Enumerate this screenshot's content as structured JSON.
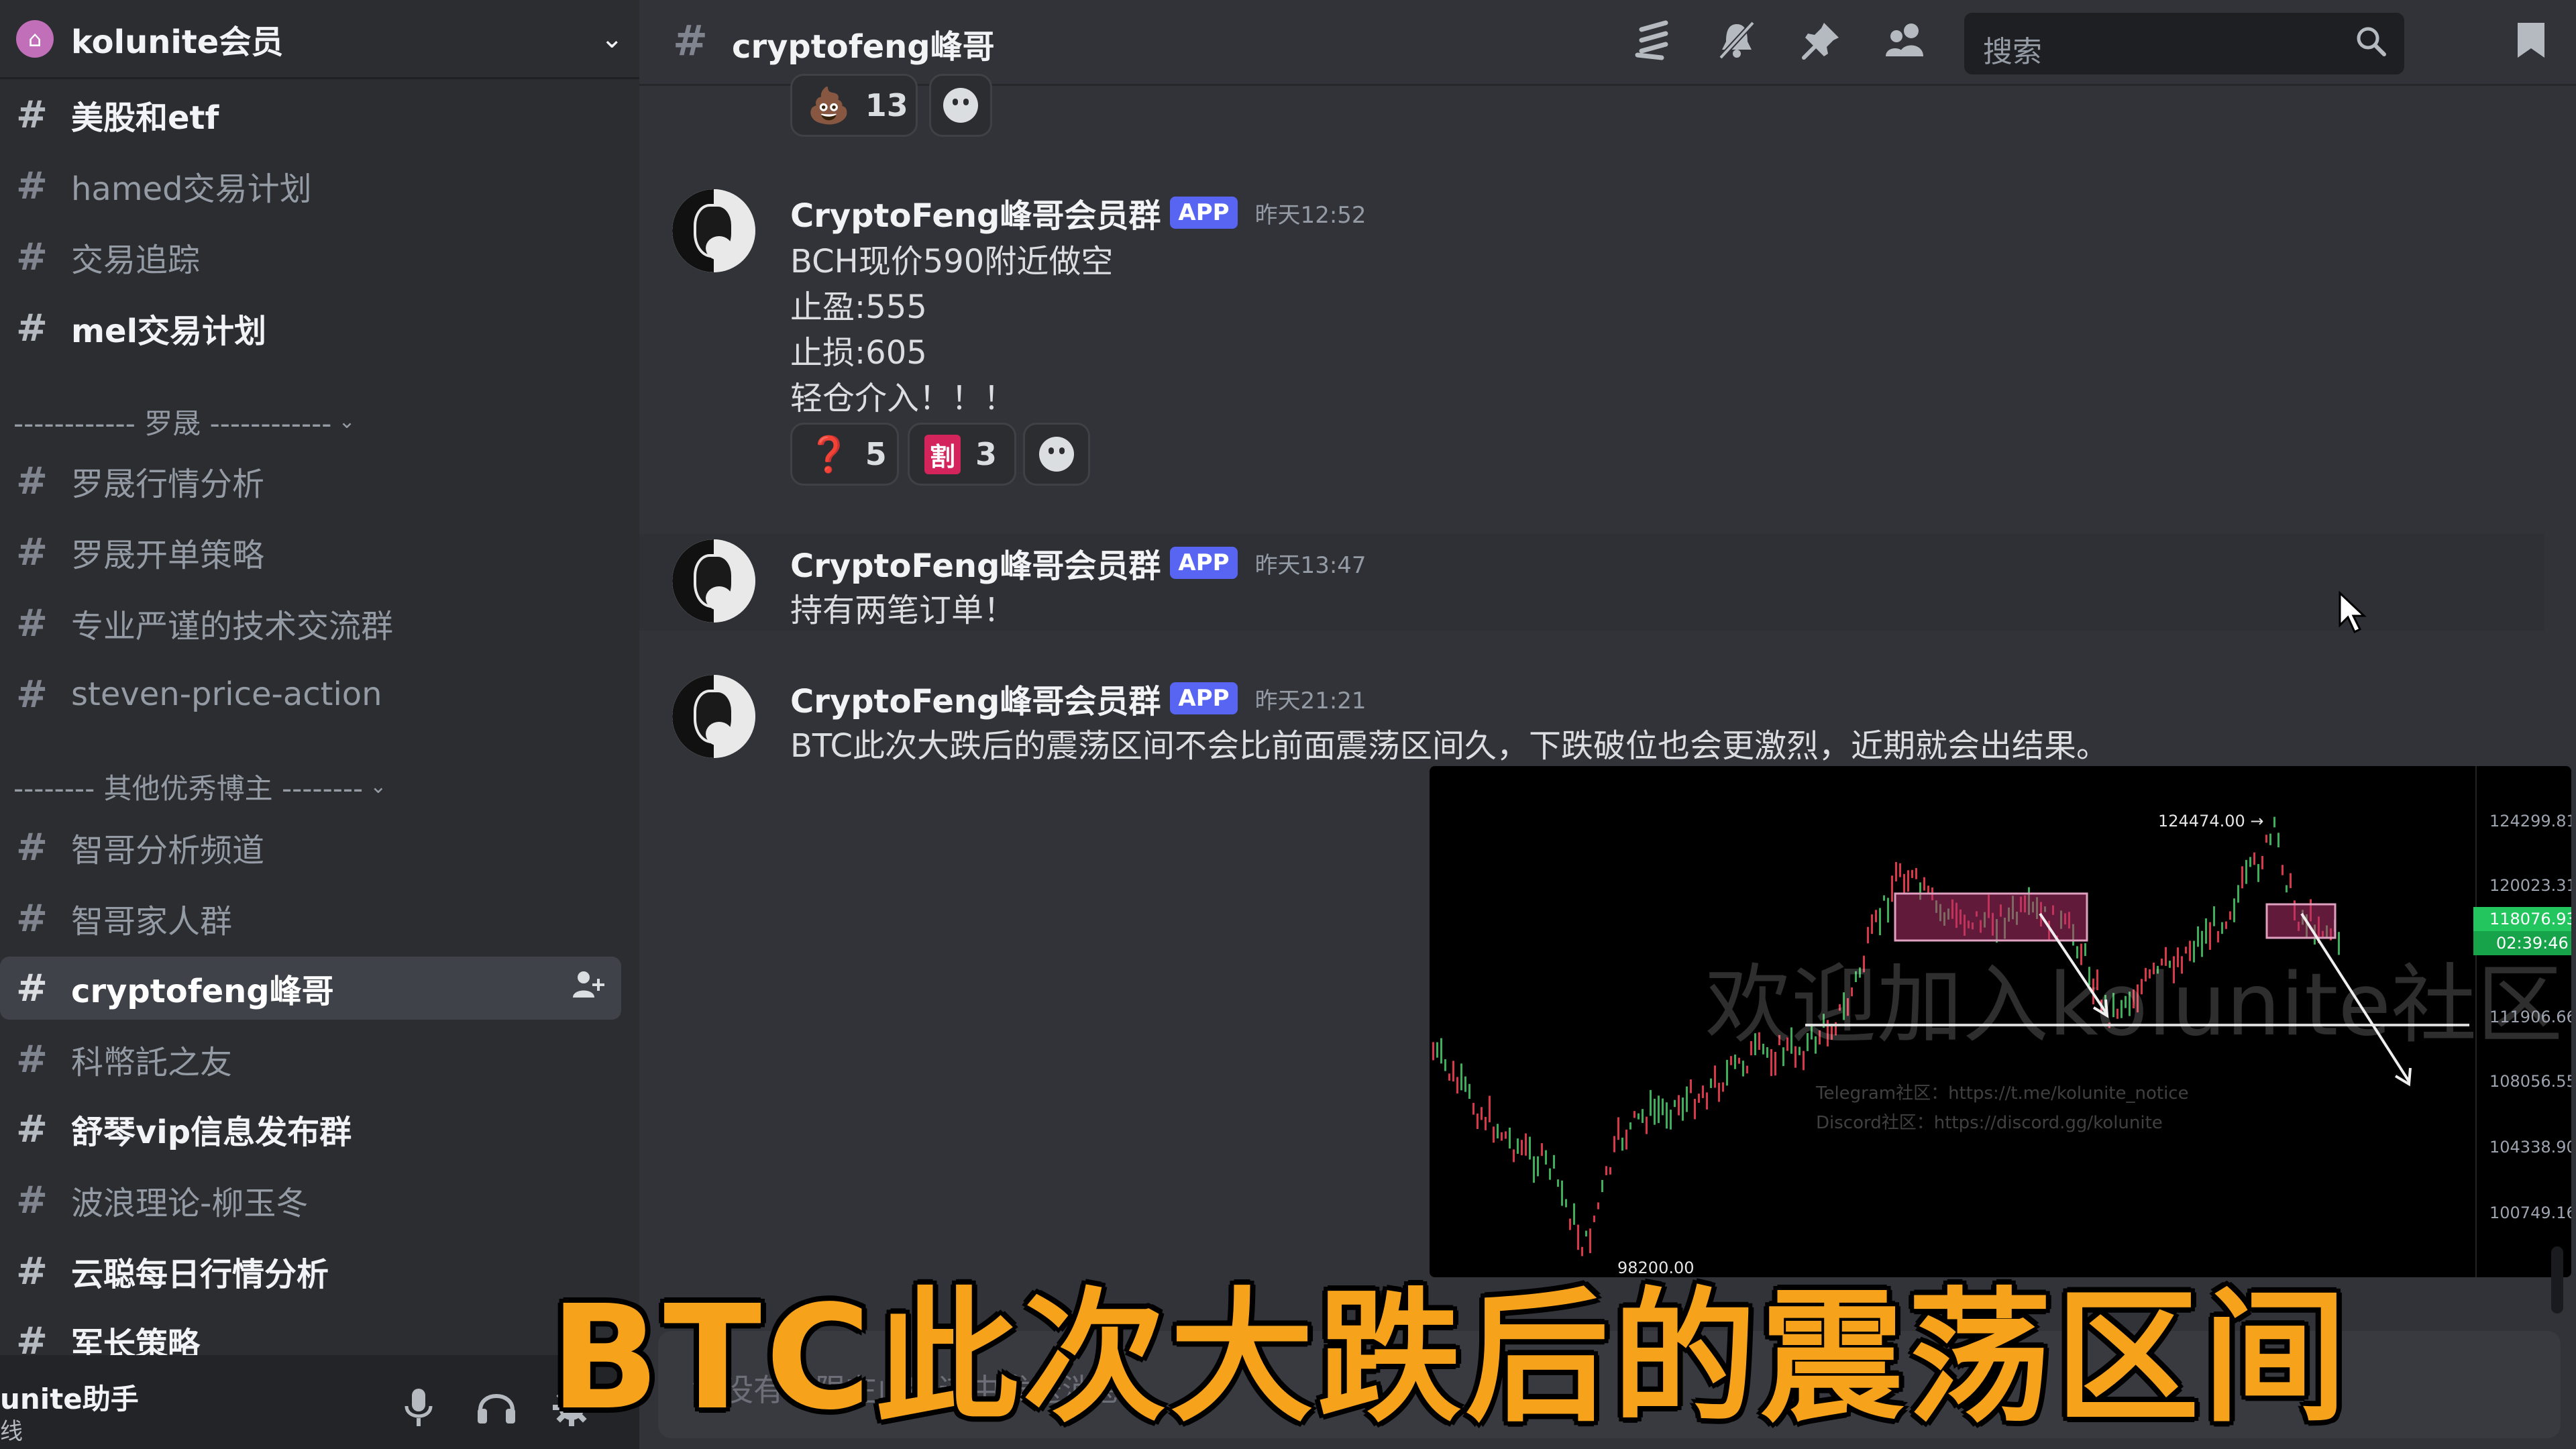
{
  "server": {
    "name": "kolunite会员",
    "icon": "⌂",
    "chevron": "⌄"
  },
  "channels_top": [
    {
      "name": "美股和etf",
      "unread": true
    },
    {
      "name": "hamed交易计划",
      "unread": false
    },
    {
      "name": "交易追踪",
      "unread": false
    },
    {
      "name": "mel交易计划",
      "unread": true
    }
  ],
  "category1": {
    "label": "------------ 罗晟 ------------",
    "chevron": "⌄"
  },
  "channels_mid": [
    {
      "name": "罗晟行情分析"
    },
    {
      "name": "罗晟开单策略"
    },
    {
      "name": "专业严谨的技术交流群"
    },
    {
      "name": "steven-price-action"
    }
  ],
  "category2": {
    "label": "-------- 其他优秀博主 --------",
    "chevron": "⌄"
  },
  "channels_bottom": [
    {
      "name": "智哥分析频道",
      "unread": false
    },
    {
      "name": "智哥家人群",
      "unread": false
    },
    {
      "name": "cryptofeng峰哥",
      "active": true
    },
    {
      "name": "科幣託之友",
      "unread": false
    },
    {
      "name": "舒琴vip信息发布群",
      "unread": true
    },
    {
      "name": "波浪理论-柳玉冬",
      "unread": false
    },
    {
      "name": "云聪每日行情分析",
      "unread": true
    },
    {
      "name": "军长策略",
      "unread": true
    }
  ],
  "hash_symbol": "#",
  "user_panel": {
    "name": "unite助手",
    "status": "线",
    "icons": [
      "mic-icon",
      "headphones-icon",
      "gear-icon"
    ]
  },
  "topbar": {
    "channel_name": "cryptofeng峰哥",
    "search_placeholder": "搜索"
  },
  "reactions_top": [
    {
      "emoji": "💩",
      "count": "13"
    }
  ],
  "messages": [
    {
      "author": "CryptoFeng峰哥会员群",
      "badge": "APP",
      "time": "昨天12:52",
      "lines": [
        "BCH现价590附近做空",
        "止盈:555",
        "止损:605",
        "轻仓介入！！！"
      ],
      "reactions": [
        {
          "emoji": "❓",
          "count": "5"
        },
        {
          "emoji": "割",
          "count": "3"
        }
      ]
    },
    {
      "author": "CryptoFeng峰哥会员群",
      "badge": "APP",
      "time": "昨天13:47",
      "lines": [
        "持有两笔订单！"
      ]
    },
    {
      "author": "CryptoFeng峰哥会员群",
      "badge": "APP",
      "time": "昨天21:21",
      "lines": [
        "BTC此次大跌后的震荡区间不会比前面震荡区间久，下跌破位也会更激烈，近期就会出结果。"
      ]
    }
  ],
  "chart_image": {
    "watermark": "欢迎加入kolunite社区",
    "telegram": "Telegram社区：https://t.me/kolunite_notice",
    "discord": "Discord社区：https://discord.gg/kolunite",
    "high_label": "124474.00 →",
    "low_label": "98200.00",
    "price_ticks": [
      "124299.81",
      "120023.31",
      "111906.66",
      "108056.55",
      "104338.90",
      "100749.16"
    ],
    "current_price": "118076.93",
    "countdown": "02:39:46"
  },
  "composer_placeholder": "您没有权限在此频道中发送消息。",
  "caption": "BTC此次大跌后的震荡区间",
  "colors": {
    "accent": "#5865f2",
    "caption": "#f7a21b",
    "price_green": "#22c55e"
  }
}
